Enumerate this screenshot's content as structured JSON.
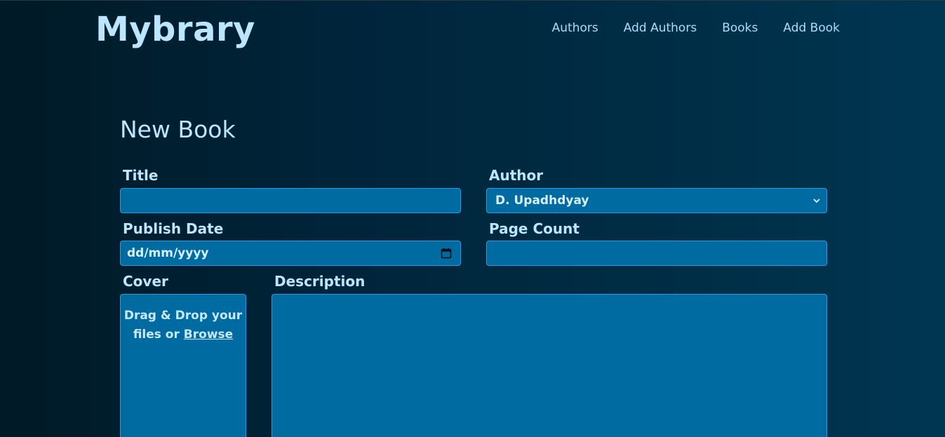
{
  "header": {
    "brand": "Mybrary",
    "nav": [
      "Authors",
      "Add Authors",
      "Books",
      "Add Book"
    ]
  },
  "page": {
    "title": "New Book"
  },
  "form": {
    "title_label": "Title",
    "title_value": "",
    "author_label": "Author",
    "author_selected": "D. Upadhdyay",
    "publish_date_label": "Publish Date",
    "publish_date_placeholder": "dd/mm/yyyy",
    "page_count_label": "Page Count",
    "page_count_value": "",
    "cover_label": "Cover",
    "cover_text_1": "Drag & Drop your",
    "cover_text_2": "files or",
    "cover_browse": "Browse",
    "description_label": "Description",
    "description_value": ""
  },
  "icons": {
    "author_dropdown": "chevron-down-icon",
    "date_picker": "calendar-icon"
  },
  "colors": {
    "field_bg": "#006ba0",
    "field_border": "#2a9be0",
    "text": "#bce6ff"
  }
}
